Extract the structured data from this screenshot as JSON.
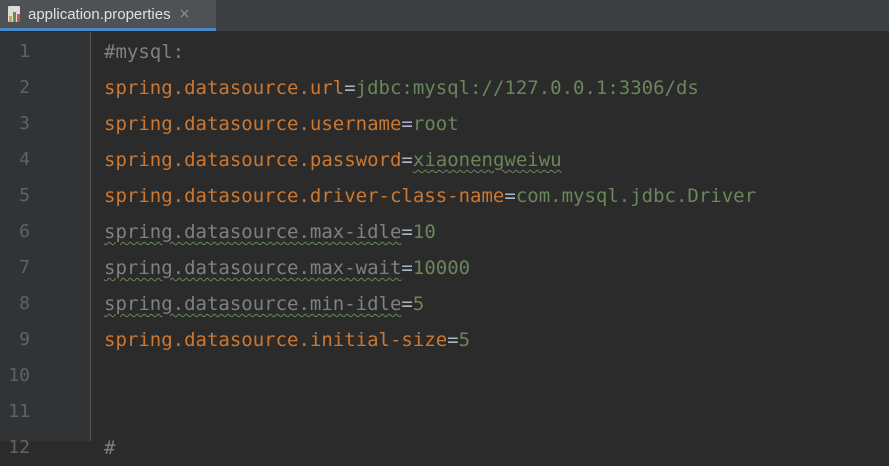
{
  "tab": {
    "title": "application.properties",
    "icon": "properties-file-icon",
    "close_icon": "close-icon",
    "close_glyph": "×"
  },
  "line_numbers": [
    "1",
    "2",
    "3",
    "4",
    "5",
    "6",
    "7",
    "8",
    "9",
    "10",
    "11",
    "12"
  ],
  "lines": [
    {
      "comment": "#mysql:"
    },
    {
      "key": "spring.datasource.url",
      "eq": "=",
      "value": "jdbc:mysql://127.0.0.1:3306/ds"
    },
    {
      "key": "spring.datasource.username",
      "eq": "=",
      "value": "root"
    },
    {
      "key": "spring.datasource.password",
      "eq": "=",
      "value": "xiaonengweiwu"
    },
    {
      "key": "spring.datasource.driver-class-name",
      "eq": "=",
      "value": "com.mysql.jdbc.Driver"
    },
    {
      "key": "spring.datasource.max-idle",
      "eq": "=",
      "value": "10"
    },
    {
      "key": "spring.datasource.max-wait",
      "eq": "=",
      "value": "10000"
    },
    {
      "key": "spring.datasource.min-idle",
      "eq": "=",
      "value": "5"
    },
    {
      "key": "spring.datasource.initial-size",
      "eq": "=",
      "value": "5"
    },
    {},
    {},
    {
      "comment": "#"
    }
  ],
  "colors": {
    "background": "#2b2b2b",
    "gutter": "#313335",
    "key": "#cc7832",
    "value": "#6a8759",
    "comment": "#808080",
    "line_number": "#606366"
  }
}
